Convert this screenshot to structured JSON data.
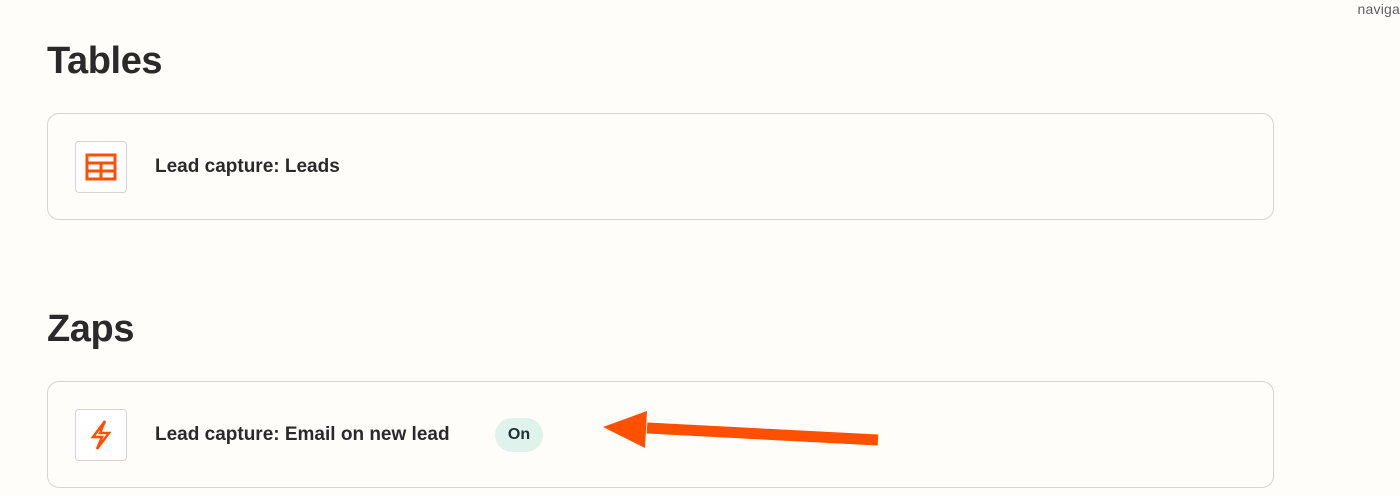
{
  "top_corner": {
    "text": "naviga"
  },
  "tables_section": {
    "title": "Tables",
    "items": [
      {
        "label": "Lead capture: Leads",
        "icon": "table-icon"
      }
    ]
  },
  "zaps_section": {
    "title": "Zaps",
    "items": [
      {
        "label": "Lead capture: Email on new lead",
        "status": "On",
        "icon": "zap-bolt-icon"
      }
    ]
  },
  "colors": {
    "accent_orange": "#ff4f00",
    "status_on_bg": "#dff3ec"
  }
}
